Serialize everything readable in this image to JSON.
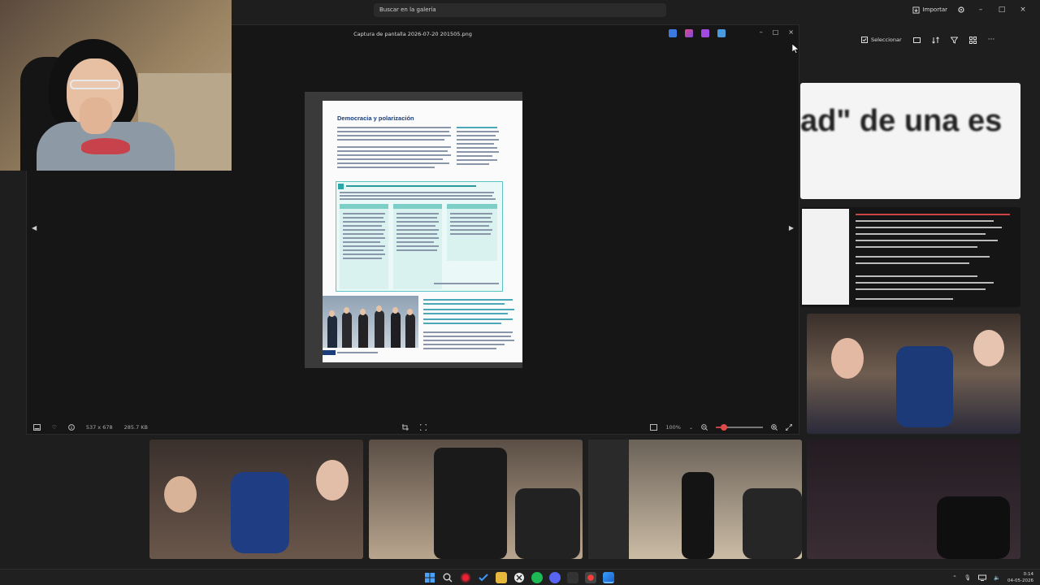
{
  "gallery": {
    "search_placeholder": "Buscar en la galería",
    "import_label": "Importar",
    "select_label": "Seleccionar",
    "thumb_text_blurred": "ad\" de una es"
  },
  "viewer": {
    "title": "Captura de pantalla 2026-07-20 201505.png",
    "doc_title": "Democracia y polarización",
    "dimensions": "537 x 678",
    "file_size": "285.7 KB",
    "zoom": "100%"
  },
  "taskbar": {
    "time": "0:14",
    "date": "04-05-2026"
  }
}
